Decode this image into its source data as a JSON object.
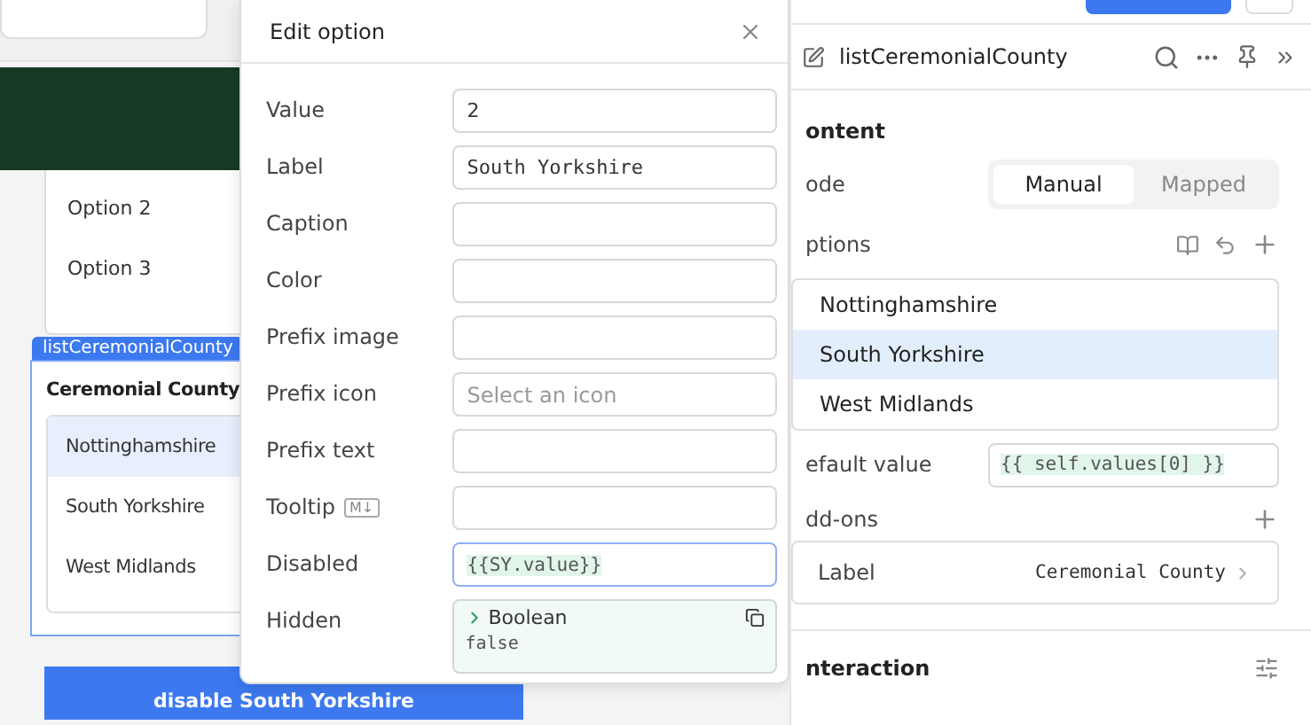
{
  "canvas": {
    "list_above": {
      "items": [
        "Option 2",
        "Option 3"
      ]
    },
    "component_tag": "listCeremonialCounty",
    "list_title": "Ceremonial County",
    "list_items": [
      {
        "label": "Nottinghamshire",
        "selected": true
      },
      {
        "label": "South Yorkshire",
        "selected": false
      },
      {
        "label": "West Midlands",
        "selected": false
      }
    ],
    "button": "disable South Yorkshire"
  },
  "dialog": {
    "title": "Edit option",
    "fields": [
      {
        "label": "Value",
        "kind": "text",
        "value": "2"
      },
      {
        "label": "Label",
        "kind": "text",
        "value": "South Yorkshire"
      },
      {
        "label": "Caption",
        "kind": "text"
      },
      {
        "label": "Color",
        "kind": "text"
      },
      {
        "label": "Prefix image",
        "kind": "text"
      },
      {
        "label": "Prefix icon",
        "kind": "select",
        "placeholder": "Select an icon"
      },
      {
        "label": "Prefix text",
        "kind": "text"
      },
      {
        "label": "Tooltip",
        "kind": "text",
        "badge": "M↓"
      },
      {
        "label": "Disabled",
        "kind": "code",
        "value": "{{SY.value}}",
        "focused": true
      },
      {
        "label": "Hidden",
        "kind": "preview",
        "type": "Boolean",
        "value": "false"
      }
    ]
  },
  "inspector": {
    "title": "listCeremonialCounty",
    "section": "ontent",
    "mode": {
      "label": "ode",
      "options": [
        {
          "label": "Manual",
          "selected": true
        },
        {
          "label": "Mapped",
          "selected": false
        }
      ]
    },
    "options_label": "ptions",
    "options": [
      {
        "label": "Nottinghamshire",
        "selected": false
      },
      {
        "label": "South Yorkshire",
        "selected": true
      },
      {
        "label": "West Midlands",
        "selected": false
      }
    ],
    "default_value": {
      "label": "efault value",
      "value": "{{ self.values[0] }}"
    },
    "addons": {
      "label": "dd-ons",
      "rows": [
        {
          "label": "Label",
          "value": "Ceremonial County"
        }
      ]
    },
    "interaction": "nteraction"
  }
}
